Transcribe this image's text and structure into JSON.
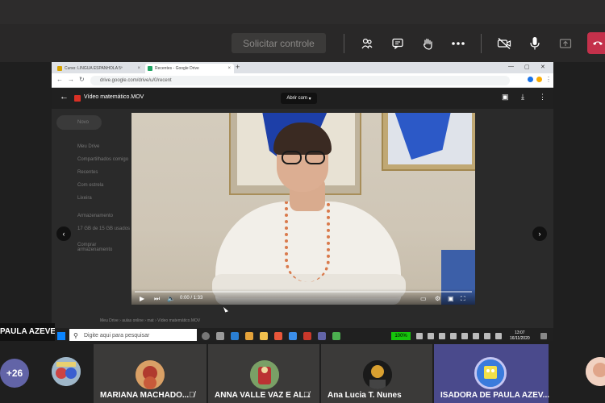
{
  "meeting": {
    "request_control_label": "Solicitar controle",
    "controls": {
      "participants_icon": "people-icon",
      "chat_icon": "chat-icon",
      "raise_hand_icon": "hand-icon",
      "more_icon": "ellipsis-icon",
      "camera_icon": "camera-off-icon",
      "mic_icon": "mic-icon",
      "share_icon": "share-tray-icon",
      "leave_icon": "phone-leave-icon"
    },
    "presenter_label": "PAULA AZEVEDO",
    "accent_color": "#6264a7",
    "leave_color": "#c4314b"
  },
  "browser": {
    "tabs": [
      {
        "label": "Curso: LINGUA ESPANHOLA 5º",
        "active": false
      },
      {
        "label": "Recentes - Google Drive",
        "active": true
      }
    ],
    "url": "drive.google.com/drive/u/0/recent",
    "drive": {
      "file_title": "Vídeo matemático.MOV",
      "open_with_label": "Abrir com",
      "sidebar": [
        "Novo",
        "Meu Drive",
        "Compartilhados comigo",
        "Recentes",
        "Com estrela",
        "Lixeira",
        "Armazenamento",
        "17 GB de 15 GB usados",
        "Comprar armazenamento"
      ],
      "breadcrumb": "Meu Drive › aulas online › mat › Vídeo matemático.MOV"
    },
    "video": {
      "time": "0:00 / 1:33",
      "progress": 0.0
    }
  },
  "taskbar": {
    "search_placeholder": "Digite aqui para pesquisar",
    "battery": "100%",
    "time": "13:07",
    "date": "16/11/2020"
  },
  "participants": {
    "more_count": "+26",
    "tiles": [
      {
        "name": "MARIANA MACHADO...",
        "muted": true
      },
      {
        "name": "ANNA VALLE VAZ E AL...",
        "muted": true
      },
      {
        "name": "Ana Lucia T. Nunes",
        "muted": false
      },
      {
        "name": "ISADORA DE PAULA AZEV...",
        "muted": false
      }
    ]
  }
}
